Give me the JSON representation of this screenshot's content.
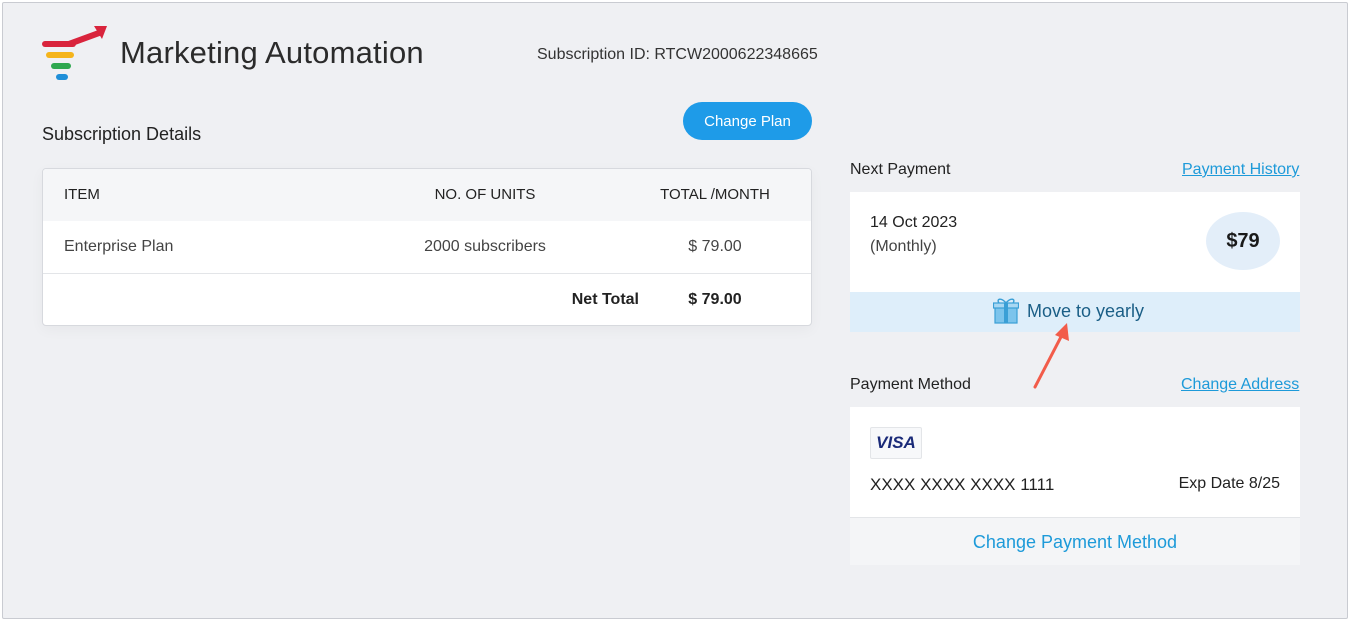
{
  "header": {
    "app_title": "Marketing Automation",
    "subscription_id": "Subscription ID: RTCW2000622348665"
  },
  "subscription": {
    "section_title": "Subscription Details",
    "change_plan_label": "Change Plan",
    "columns": [
      "ITEM",
      "NO. OF UNITS",
      "TOTAL /MONTH"
    ],
    "rows": [
      {
        "item": "Enterprise Plan",
        "units": "2000 subscribers",
        "total": "$  79.00"
      }
    ],
    "net_total_label": "Net Total",
    "net_total_value": "$ 79.00"
  },
  "next_payment": {
    "label": "Next Payment",
    "history_link": "Payment History",
    "date": "14 Oct 2023",
    "frequency": "(Monthly)",
    "amount": "$79",
    "move_yearly_label": "Move to yearly"
  },
  "payment_method": {
    "label": "Payment Method",
    "change_address_link": "Change Address",
    "card_brand": "VISA",
    "card_number": "XXXX XXXX XXXX 1111",
    "exp_date": "Exp Date 8/25",
    "change_method_label": "Change Payment Method"
  },
  "colors": {
    "accent": "#1e9be8",
    "link": "#1d9ad9",
    "background": "#eff0f3",
    "highlight_bar": "#deeefa",
    "annotation_arrow": "#f25c4a"
  }
}
